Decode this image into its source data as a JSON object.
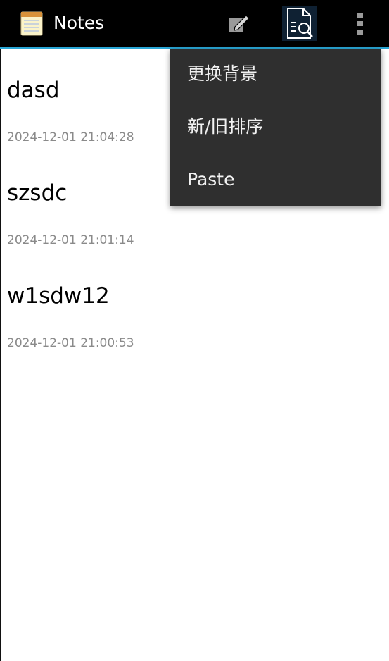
{
  "app": {
    "title": "Notes"
  },
  "toolbar": {
    "edit_icon": "pencil-edit-icon",
    "search_icon": "document-search-icon",
    "overflow_icon": "overflow-menu-icon"
  },
  "notes": [
    {
      "title": "dasd",
      "date": "2024-12-01 21:04:28"
    },
    {
      "title": "szsdc",
      "date": "2024-12-01 21:01:14"
    },
    {
      "title": "w1sdw12",
      "date": "2024-12-01 21:00:53"
    }
  ],
  "menu": {
    "items": [
      {
        "label": "更换背景"
      },
      {
        "label": "新/旧排序"
      },
      {
        "label": "Paste"
      }
    ]
  },
  "colors": {
    "actionbar": "#000000",
    "accent": "#2aa7d6",
    "menu_bg": "#2f2f2f",
    "date_text": "#8a8a8a"
  }
}
